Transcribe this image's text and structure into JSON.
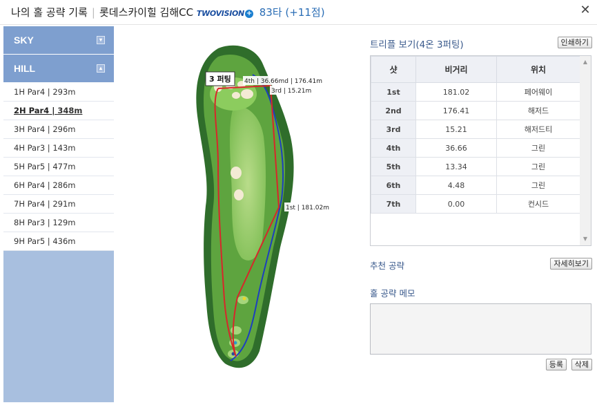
{
  "header": {
    "title": "나의 홀 공략 기록",
    "course": "롯데스카이힐 김해CC",
    "brand": "TWOVISION",
    "brand_plus": "+",
    "score": "83타 (+11점)",
    "close": "✕"
  },
  "sidebar": {
    "courses": [
      {
        "label": "SKY",
        "toggle": "▾"
      },
      {
        "label": "HILL",
        "toggle": "▴"
      }
    ],
    "holes": [
      {
        "name": "1H Par4",
        "dist": "293m"
      },
      {
        "name": "2H Par4",
        "dist": "348m",
        "active": true
      },
      {
        "name": "3H Par4",
        "dist": "296m"
      },
      {
        "name": "4H Par3",
        "dist": "143m"
      },
      {
        "name": "5H Par5",
        "dist": "477m"
      },
      {
        "name": "6H Par4",
        "dist": "286m"
      },
      {
        "name": "7H Par4",
        "dist": "291m"
      },
      {
        "name": "8H Par3",
        "dist": "129m"
      },
      {
        "name": "9H Par5",
        "dist": "436m"
      }
    ]
  },
  "map": {
    "putt_label": "3 퍼팅",
    "label_4th": "4th | 36.66md | 176.41m",
    "label_3rd": "3rd | 15.21m",
    "label_1st": "1st | 181.02m"
  },
  "triple": {
    "title": "트리플 보기(4온 3퍼팅)",
    "print_button": "인쇄하기",
    "headers": [
      "샷",
      "비거리",
      "위치"
    ],
    "rows": [
      {
        "shot": "1st",
        "distance": "181.02",
        "location": "페어웨이"
      },
      {
        "shot": "2nd",
        "distance": "176.41",
        "location": "해저드"
      },
      {
        "shot": "3rd",
        "distance": "15.21",
        "location": "해저드티"
      },
      {
        "shot": "4th",
        "distance": "36.66",
        "location": "그린"
      },
      {
        "shot": "5th",
        "distance": "13.34",
        "location": "그린"
      },
      {
        "shot": "6th",
        "distance": "4.48",
        "location": "그린"
      },
      {
        "shot": "7th",
        "distance": "0.00",
        "location": "컨시드"
      }
    ]
  },
  "recommend": {
    "title": "추천 공략",
    "detail_button": "자세히보기"
  },
  "memo": {
    "title": "홀 공략 메모",
    "value": "",
    "register_button": "등록",
    "delete_button": "삭제"
  },
  "colors": {
    "accent": "#3a5a8c",
    "sidebar_bg": "#a8bfdf",
    "sidebar_header": "#7e9fcf",
    "route_red": "#d8262a",
    "route_blue": "#1c3fbf"
  }
}
